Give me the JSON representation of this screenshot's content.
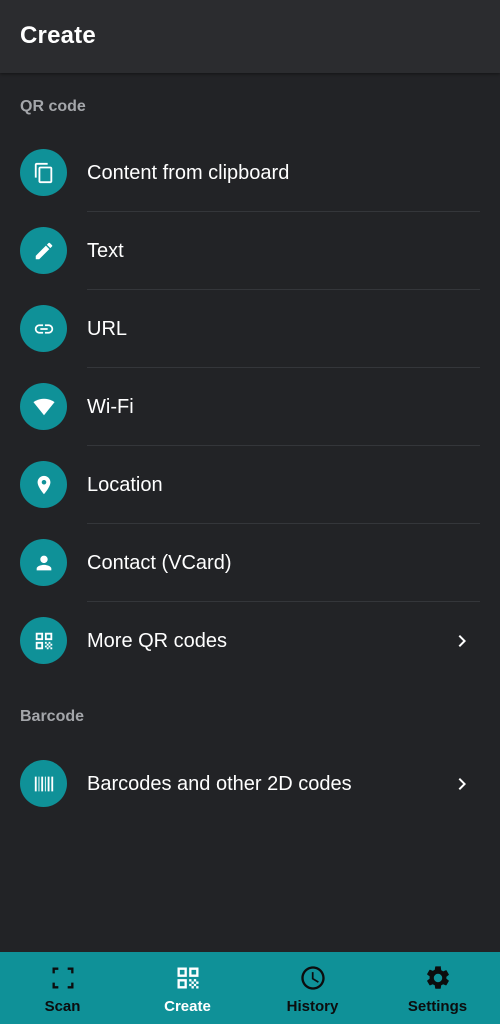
{
  "app_bar": {
    "title": "Create"
  },
  "sections": {
    "qr": {
      "header": "QR code",
      "items": [
        {
          "label": "Content from clipboard",
          "icon": "clipboard-icon"
        },
        {
          "label": "Text",
          "icon": "pencil-icon"
        },
        {
          "label": "URL",
          "icon": "link-icon"
        },
        {
          "label": "Wi-Fi",
          "icon": "wifi-icon"
        },
        {
          "label": "Location",
          "icon": "location-pin-icon"
        },
        {
          "label": "Contact (VCard)",
          "icon": "person-icon"
        },
        {
          "label": "More QR codes",
          "icon": "qr-code-icon",
          "chevron": true
        }
      ]
    },
    "barcode": {
      "header": "Barcode",
      "items": [
        {
          "label": "Barcodes and other 2D codes",
          "icon": "barcode-icon",
          "chevron": true
        }
      ]
    }
  },
  "bottom_nav": [
    {
      "label": "Scan",
      "icon": "scan-icon",
      "active": false
    },
    {
      "label": "Create",
      "icon": "qr-code-icon",
      "active": true
    },
    {
      "label": "History",
      "icon": "clock-icon",
      "active": false
    },
    {
      "label": "Settings",
      "icon": "gear-icon",
      "active": false
    }
  ],
  "colors": {
    "accent": "#0f9198",
    "background": "#222326",
    "app_bar": "#2b2c2f",
    "section_header": "#a4a6aa"
  }
}
